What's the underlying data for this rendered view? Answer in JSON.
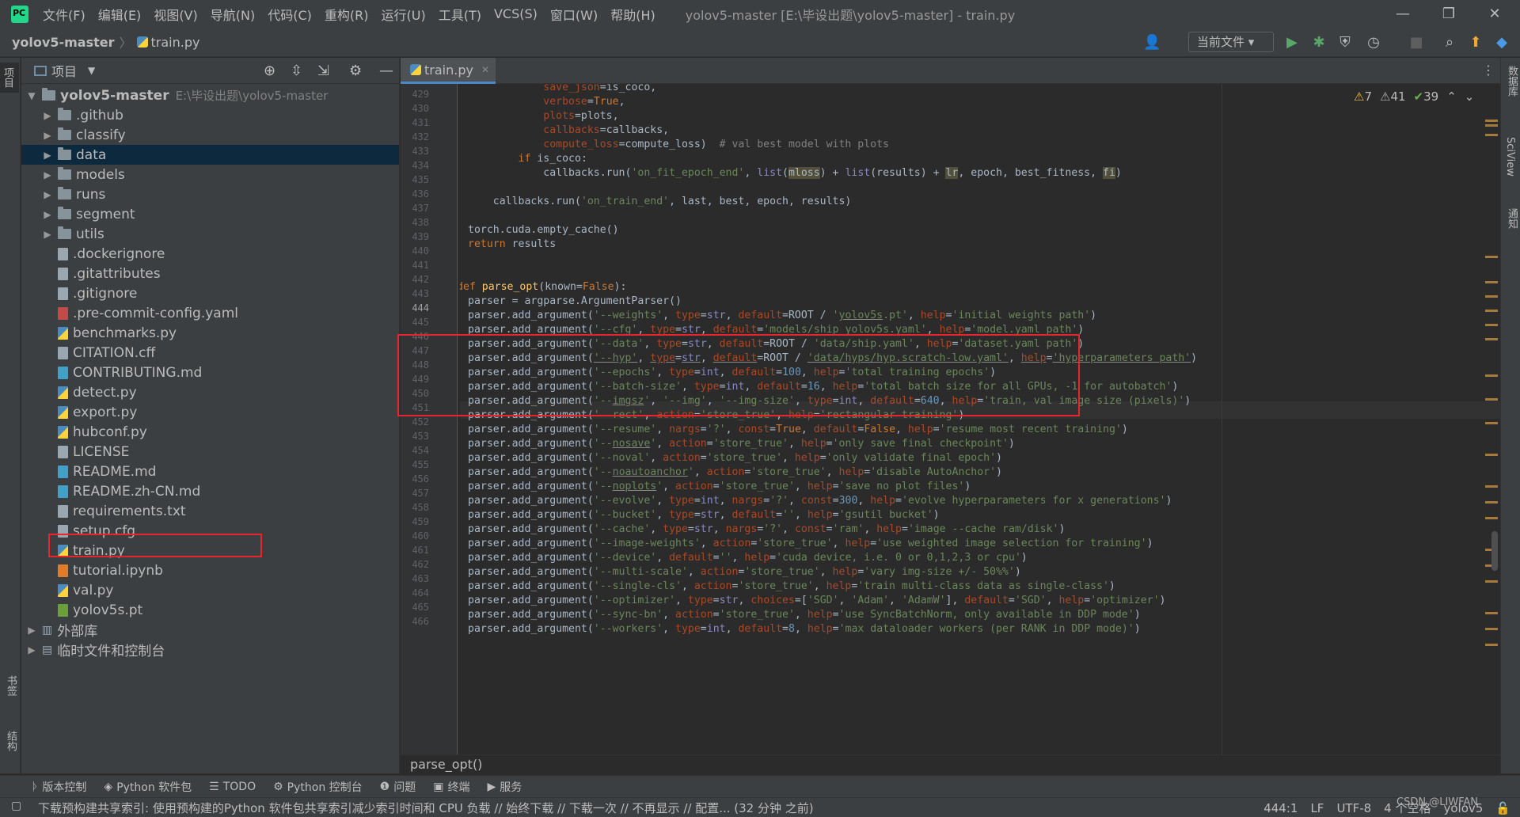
{
  "titlebar": {
    "menus": [
      "文件(F)",
      "编辑(E)",
      "视图(V)",
      "导航(N)",
      "代码(C)",
      "重构(R)",
      "运行(U)",
      "工具(T)",
      "VCS(S)",
      "窗口(W)",
      "帮助(H)"
    ],
    "window_title": "yolov5-master [E:\\毕设出题\\yolov5-master] - train.py",
    "minimize": "—",
    "maximize": "❐",
    "close": "✕"
  },
  "navbar": {
    "project": "yolov5-master",
    "separator": "〉",
    "file": "train.py",
    "run_config": "当前文件 ▾",
    "icons": [
      "user-icon",
      "run-icon",
      "debug-icon",
      "coverage-icon",
      "profile-icon",
      "stop-icon",
      "search-icon",
      "update-icon",
      "jetbrains-icon"
    ]
  },
  "left_strip": {
    "project": "项目",
    "bookmarks": "书签",
    "structure": "结构"
  },
  "right_strip": {
    "database": "数据库",
    "sciview": "SciView",
    "notifications": "通知"
  },
  "project_panel": {
    "title": "项目",
    "root": {
      "name": "yolov5-master",
      "path": "E:\\毕设出题\\yolov5-master"
    },
    "items": [
      {
        "name": ".github",
        "type": "folder"
      },
      {
        "name": "classify",
        "type": "folder"
      },
      {
        "name": "data",
        "type": "folder",
        "selected": true
      },
      {
        "name": "models",
        "type": "folder"
      },
      {
        "name": "runs",
        "type": "folder"
      },
      {
        "name": "segment",
        "type": "folder"
      },
      {
        "name": "utils",
        "type": "folder"
      },
      {
        "name": ".dockerignore",
        "type": "file"
      },
      {
        "name": ".gitattributes",
        "type": "file"
      },
      {
        "name": ".gitignore",
        "type": "file"
      },
      {
        "name": ".pre-commit-config.yaml",
        "type": "yml"
      },
      {
        "name": "benchmarks.py",
        "type": "py"
      },
      {
        "name": "CITATION.cff",
        "type": "file"
      },
      {
        "name": "CONTRIBUTING.md",
        "type": "md"
      },
      {
        "name": "detect.py",
        "type": "py"
      },
      {
        "name": "export.py",
        "type": "py"
      },
      {
        "name": "hubconf.py",
        "type": "py"
      },
      {
        "name": "LICENSE",
        "type": "file"
      },
      {
        "name": "README.md",
        "type": "md"
      },
      {
        "name": "README.zh-CN.md",
        "type": "md"
      },
      {
        "name": "requirements.txt",
        "type": "file"
      },
      {
        "name": "setup.cfg",
        "type": "file"
      },
      {
        "name": "train.py",
        "type": "py"
      },
      {
        "name": "tutorial.ipynb",
        "type": "ipynb"
      },
      {
        "name": "val.py",
        "type": "py"
      },
      {
        "name": "yolov5s.pt",
        "type": "pt"
      }
    ],
    "external_libs": "外部库",
    "scratches": "临时文件和控制台"
  },
  "editor": {
    "tab": "train.py",
    "inspections": {
      "warnings": "7",
      "weak_warnings": "41",
      "typos": "39"
    },
    "current_line": 444,
    "breadcrumb": "parse_opt()",
    "line_numbers": [
      429,
      430,
      431,
      432,
      433,
      434,
      435,
      436,
      437,
      438,
      439,
      440,
      441,
      442,
      443,
      444,
      445,
      446,
      447,
      448,
      449,
      450,
      451,
      452,
      453,
      454,
      455,
      456,
      457,
      458,
      459,
      460,
      461,
      462,
      463,
      464,
      465,
      466
    ]
  },
  "toolwindows": [
    {
      "icon": "vcs-icon",
      "glyph": "ᚦ",
      "label": "版本控制"
    },
    {
      "icon": "python-packages-icon",
      "glyph": "◈",
      "label": "Python 软件包"
    },
    {
      "icon": "todo-icon",
      "glyph": "☰",
      "label": "TODO"
    },
    {
      "icon": "python-console-icon",
      "glyph": "⚙",
      "label": "Python 控制台"
    },
    {
      "icon": "problems-icon",
      "glyph": "❶",
      "label": "问题"
    },
    {
      "icon": "terminal-icon",
      "glyph": "▣",
      "label": "终端"
    },
    {
      "icon": "services-icon",
      "glyph": "▶",
      "label": "服务"
    }
  ],
  "statusbar": {
    "message": "下载预构建共享索引: 使用预构建的Python 软件包共享索引减少索引时间和 CPU 负载 // 始终下载 // 下载一次 // 不再显示 // 配置... (32 分钟 之前)",
    "position": "444:1",
    "line_sep": "LF",
    "encoding": "UTF-8",
    "indent": "4 个空格",
    "interpreter": "yolov5",
    "watermark": "CSDN @LIWFAN"
  },
  "colors": {
    "accent": "#4a88c7",
    "selection": "#0d293e",
    "annotation_red": "#e8242c"
  }
}
